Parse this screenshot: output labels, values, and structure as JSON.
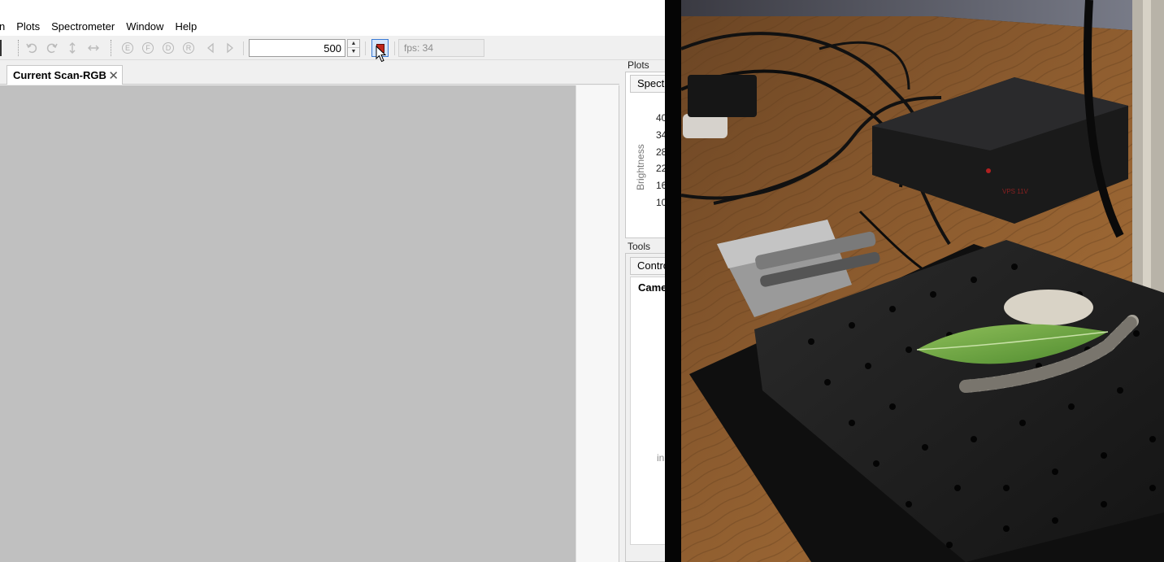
{
  "menubar": {
    "items": [
      "n",
      "Plots",
      "Spectrometer",
      "Window",
      "Help"
    ]
  },
  "toolbar": {
    "icons": [
      "undo-icon",
      "redo-icon",
      "vertical-arrows-icon",
      "horizontal-arrows-icon",
      "e-circle-icon",
      "f-circle-icon",
      "d-circle-icon",
      "r-circle-icon",
      "left-triangle-icon",
      "right-triangle-icon"
    ],
    "circle_letters": [
      "E",
      "F",
      "D",
      "R"
    ],
    "exposure_value": "500",
    "spin_up": "▲",
    "spin_down": "▼",
    "stop_color": "#c0261a",
    "fps_text": "fps: 34"
  },
  "document": {
    "tab_label": "Current Scan-RGB",
    "tab_close": "✕",
    "viewport_color": "#c0c0c0"
  },
  "plots_dock": {
    "title": "Plots",
    "tab_label": "Spectr",
    "y_axis_label": "Brightness",
    "y_ticks": [
      "40",
      "34",
      "28",
      "22",
      "16",
      "10"
    ]
  },
  "tools_dock": {
    "title": "Tools",
    "tab_label": "Contro",
    "section_label": "Came",
    "partial_text": "in"
  },
  "photo": {
    "description_icon": "camera-feed-image",
    "power_box_label": "VPS 11V"
  }
}
